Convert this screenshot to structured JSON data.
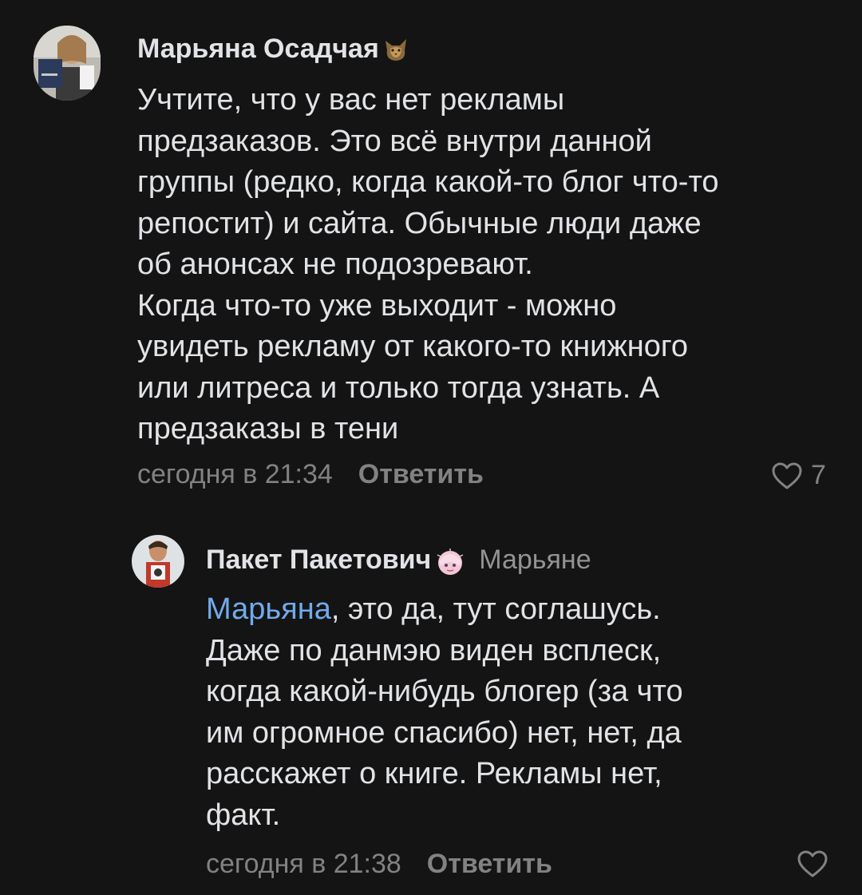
{
  "comments": [
    {
      "author": "Марьяна Осадчая",
      "emoji": "cat-emoji",
      "text": "Учтите, что у вас нет рекламы\nпредзаказов. Это всё внутри данной\nгруппы (редко, когда какой-то блог что-то\nрепостит) и сайта. Обычные люди даже\nоб анонсах не подозревают.\nКогда что-то уже выходит - можно\nувидеть рекламу от какого-то книжного\nили литреса и только тогда узнать. А\nпредзаказы в тени",
      "time": "сегодня в 21:34",
      "reply_label": "Ответить",
      "likes": "7",
      "icon": "heart-outline-icon"
    },
    {
      "author": "Пакет Пакетович",
      "emoji": "anime-girl-emoji",
      "reply_to": "Марьяне",
      "mention": "Марьяна",
      "text_after_mention": ", это да, тут соглашусь.\nДаже по данмэю виден всплеск,\nкогда какой-нибудь блогер (за что\nим огромное спасибо) нет, нет, да\nрасскажет о книге. Рекламы нет,\nфакт.",
      "time": "сегодня в 21:38",
      "reply_label": "Ответить",
      "icon": "heart-outline-icon"
    }
  ],
  "colors": {
    "background": "#141414",
    "text": "#e1e3e6",
    "secondary": "#828282",
    "mention": "#71aaeb"
  }
}
